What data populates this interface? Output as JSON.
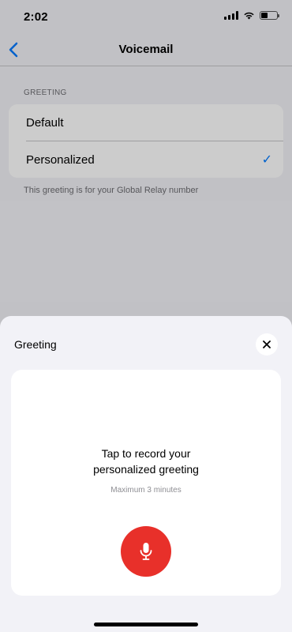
{
  "status_bar": {
    "time": "2:02",
    "battery_level": 0.4
  },
  "nav": {
    "title": "Voicemail"
  },
  "greeting_section": {
    "header": "GREETING",
    "options": [
      {
        "label": "Default",
        "selected": false
      },
      {
        "label": "Personalized",
        "selected": true
      }
    ],
    "check_glyph": "✓",
    "footer": "This greeting is for your Global Relay number"
  },
  "sheet": {
    "title": "Greeting",
    "prompt_line1": "Tap to record your",
    "prompt_line2": "personalized greeting",
    "max_duration": "Maximum 3 minutes",
    "icons": {
      "close": "close-icon",
      "record": "microphone-icon",
      "back": "chevron-left-icon"
    }
  },
  "colors": {
    "accent": "#007aff",
    "record": "#e8302a"
  }
}
